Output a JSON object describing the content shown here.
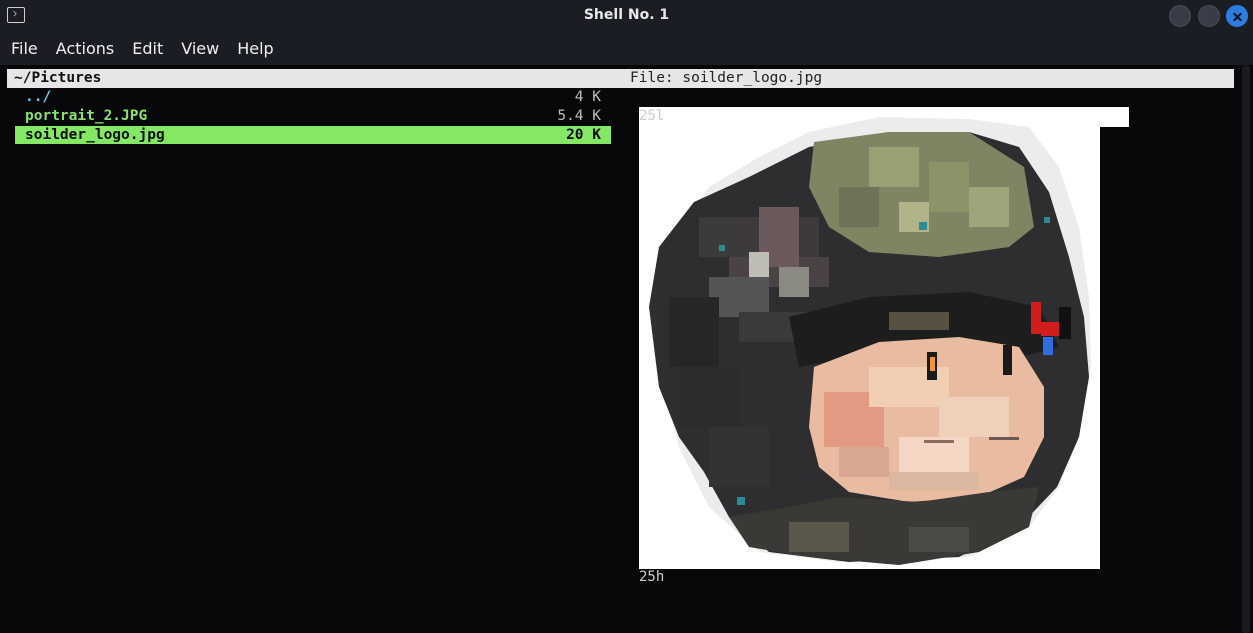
{
  "window": {
    "title": "Shell No. 1",
    "icon": "terminal-icon",
    "controls": [
      "minimize",
      "maximize",
      "close"
    ],
    "close_color": "#2d7de0"
  },
  "menu": {
    "items": [
      "File",
      "Actions",
      "Edit",
      "View",
      "Help"
    ]
  },
  "file_manager": {
    "current_dir": "~/Pictures",
    "file_label": "File: soilder_logo.jpg",
    "entries": [
      {
        "name": "../",
        "size": "4 K",
        "type": "directory",
        "color": "#5ad0e8"
      },
      {
        "name": "portrait_2.JPG",
        "size": "5.4 K",
        "type": "image",
        "color": "#8ae06b"
      },
      {
        "name": "soilder_logo.jpg",
        "size": "20 K",
        "type": "image",
        "selected": true,
        "color": "#84e865"
      }
    ]
  },
  "preview": {
    "width_label": "25l",
    "height_label": "25h",
    "subject_icon": "soldier-helmet-pixel-art"
  }
}
